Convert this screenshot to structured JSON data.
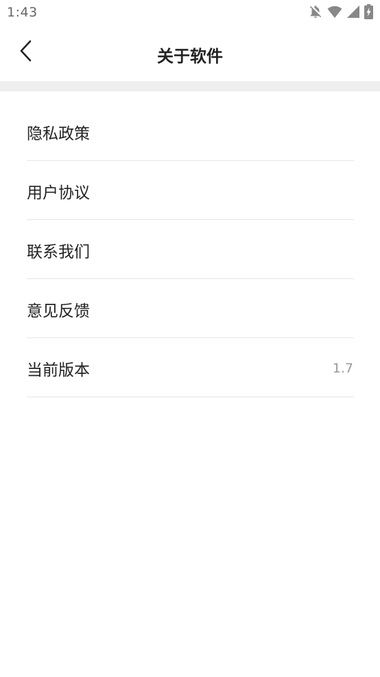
{
  "status_bar": {
    "time": "1:43",
    "icons": [
      "notifications-off-icon",
      "wifi-icon",
      "cellular-signal-icon",
      "battery-charging-icon"
    ]
  },
  "header": {
    "back_icon": "chevron-left-icon",
    "title": "关于软件"
  },
  "menu": {
    "items": [
      {
        "label": "隐私政策",
        "value": ""
      },
      {
        "label": "用户协议",
        "value": ""
      },
      {
        "label": "联系我们",
        "value": ""
      },
      {
        "label": "意见反馈",
        "value": ""
      },
      {
        "label": "当前版本",
        "value": "1.7"
      }
    ]
  },
  "colors": {
    "background": "#ffffff",
    "separator_band": "#eeeeee",
    "divider": "#e6e6e6",
    "text_primary": "#222222",
    "text_secondary": "#999999",
    "status_text": "#666666"
  }
}
